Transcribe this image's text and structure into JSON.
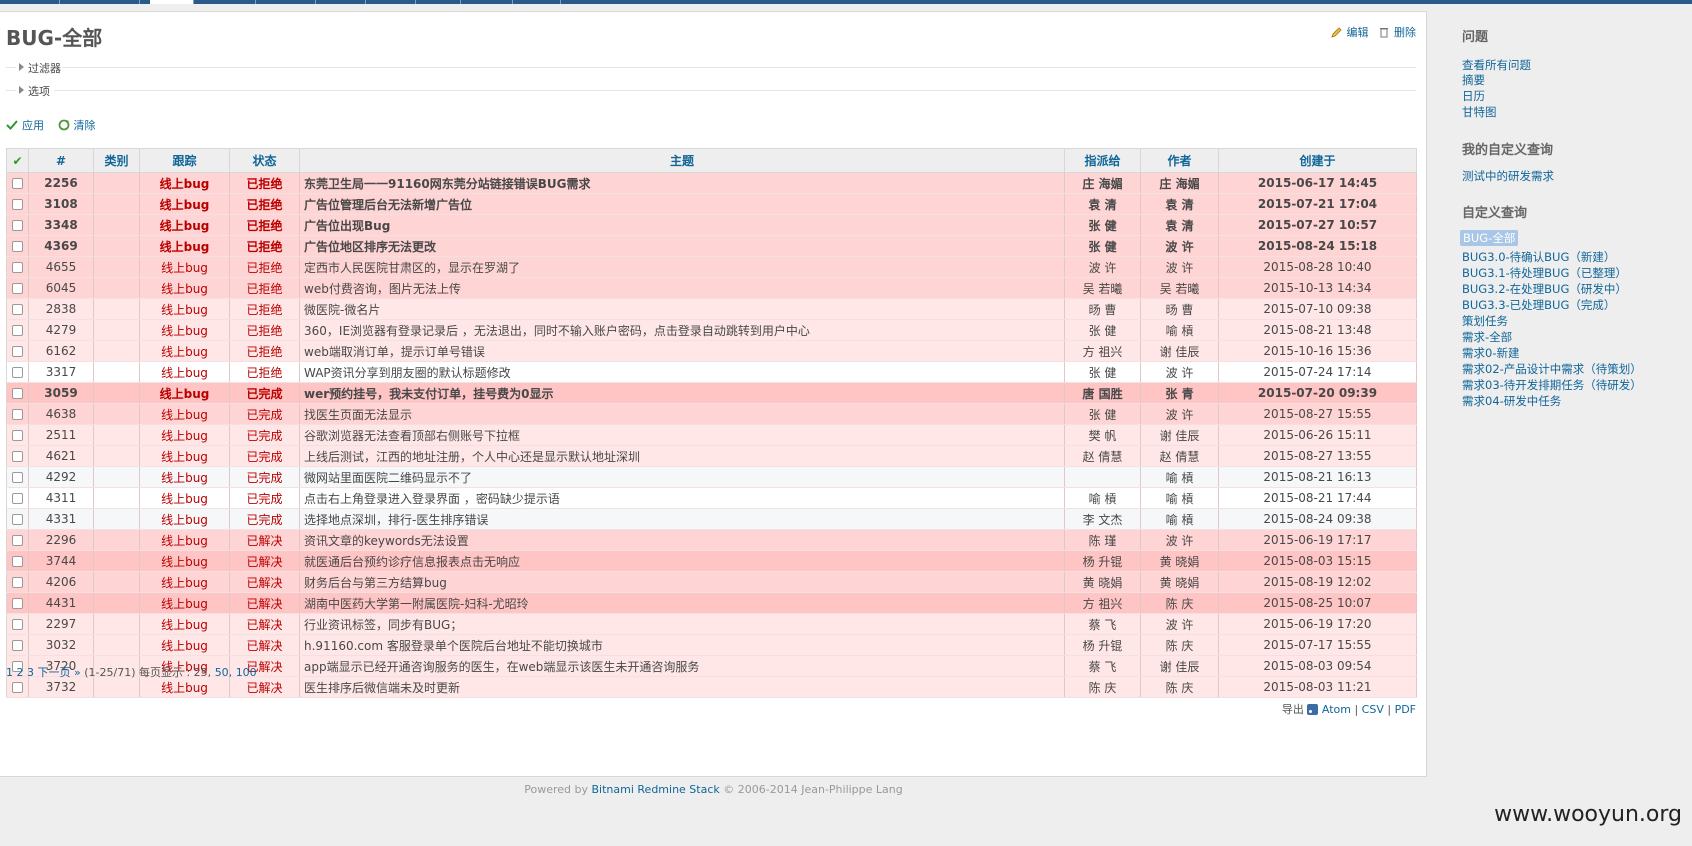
{
  "page_title": "BUG-全部",
  "contextual": {
    "edit": "编辑",
    "delete": "删除"
  },
  "filters_label": "过滤器",
  "options_label": "选项",
  "buttons": {
    "apply": "应用",
    "clear": "清除"
  },
  "table": {
    "headers": {
      "check": "✔",
      "id": "#",
      "category": "类别",
      "tracker": "跟踪",
      "status": "状态",
      "subject": "主题",
      "assignee": "指派给",
      "author": "作者",
      "created": "创建于"
    },
    "rows": [
      {
        "id": "2256",
        "tracker": "线上bug",
        "status": "已拒绝",
        "subject": "东莞卫生局一一91160网东莞分站链接错误BUG需求",
        "assignee": "庄 海媚",
        "author": "庄 海媚",
        "created": "2015-06-17 14:45",
        "style": "p-normal",
        "bold": true
      },
      {
        "id": "3108",
        "tracker": "线上bug",
        "status": "已拒绝",
        "subject": "广告位管理后台无法新增广告位",
        "assignee": "袁 清",
        "author": "袁 清",
        "created": "2015-07-21 17:04",
        "style": "p-normal",
        "bold": true
      },
      {
        "id": "3348",
        "tracker": "线上bug",
        "status": "已拒绝",
        "subject": "广告位出现Bug",
        "assignee": "张 健",
        "author": "袁 清",
        "created": "2015-07-27 10:57",
        "style": "p-normal",
        "bold": true
      },
      {
        "id": "4369",
        "tracker": "线上bug",
        "status": "已拒绝",
        "subject": "广告位地区排序无法更改",
        "assignee": "张 健",
        "author": "波 许",
        "created": "2015-08-24 15:18",
        "style": "p-normal",
        "bold": true
      },
      {
        "id": "4655",
        "tracker": "线上bug",
        "status": "已拒绝",
        "subject": "定西市人民医院甘肃区的，显示在罗湖了",
        "assignee": "波 许",
        "author": "波 许",
        "created": "2015-08-28 10:40",
        "style": "p-normal",
        "bold": false
      },
      {
        "id": "6045",
        "tracker": "线上bug",
        "status": "已拒绝",
        "subject": "web付费咨询，图片无法上传",
        "assignee": "吴 若曦",
        "author": "吴 若曦",
        "created": "2015-10-13 14:34",
        "style": "p-normal",
        "bold": false
      },
      {
        "id": "2838",
        "tracker": "线上bug",
        "status": "已拒绝",
        "subject": "微医院-微名片",
        "assignee": "旸 曹",
        "author": "旸 曹",
        "created": "2015-07-10 09:38",
        "style": "p-low",
        "bold": false
      },
      {
        "id": "4279",
        "tracker": "线上bug",
        "status": "已拒绝",
        "subject": "360，IE浏览器有登录记录后 ，无法退出，同时不输入账户密码，点击登录自动跳转到用户中心",
        "assignee": "张 健",
        "author": "喻 槓",
        "created": "2015-08-21 13:48",
        "style": "p-low",
        "bold": false
      },
      {
        "id": "6162",
        "tracker": "线上bug",
        "status": "已拒绝",
        "subject": "web端取消订单，提示订单号错误",
        "assignee": "方 祖兴",
        "author": "谢 佳辰",
        "created": "2015-10-16 15:36",
        "style": "p-low",
        "bold": false
      },
      {
        "id": "3317",
        "tracker": "线上bug",
        "status": "已拒绝",
        "subject": "WAP资讯分享到朋友圈的默认标题修改",
        "assignee": "张 健",
        "author": "波 许",
        "created": "2015-07-24 17:14",
        "style": "p-none",
        "bold": false
      },
      {
        "id": "3059",
        "tracker": "线上bug",
        "status": "已完成",
        "subject": "wer预约挂号，我未支付订单，挂号费为0显示",
        "assignee": "唐 国胜",
        "author": "张 青",
        "created": "2015-07-20 09:39",
        "style": "p-high",
        "bold": true
      },
      {
        "id": "4638",
        "tracker": "线上bug",
        "status": "已完成",
        "subject": "找医生页面无法显示",
        "assignee": "张 健",
        "author": "波 许",
        "created": "2015-08-27 15:55",
        "style": "p-normal",
        "bold": false
      },
      {
        "id": "2511",
        "tracker": "线上bug",
        "status": "已完成",
        "subject": "谷歌浏览器无法查看顶部右侧账号下拉框",
        "assignee": "樊 帆",
        "author": "谢 佳辰",
        "created": "2015-06-26 15:11",
        "style": "p-low",
        "bold": false
      },
      {
        "id": "4621",
        "tracker": "线上bug",
        "status": "已完成",
        "subject": "上线后测试，江西的地址注册，个人中心还是显示默认地址深圳",
        "assignee": "赵 倩慧",
        "author": "赵 倩慧",
        "created": "2015-08-27 13:55",
        "style": "p-low",
        "bold": false
      },
      {
        "id": "4292",
        "tracker": "线上bug",
        "status": "已完成",
        "subject": "微网站里面医院二维码显示不了",
        "assignee": "",
        "author": "喻 槓",
        "created": "2015-08-21 16:13",
        "style": "p-gray",
        "bold": false
      },
      {
        "id": "4311",
        "tracker": "线上bug",
        "status": "已完成",
        "subject": "点击右上角登录进入登录界面 ，密码缺少提示语",
        "assignee": "喻 槓",
        "author": "喻 槓",
        "created": "2015-08-21 17:44",
        "style": "p-none",
        "bold": false
      },
      {
        "id": "4331",
        "tracker": "线上bug",
        "status": "已完成",
        "subject": "选择地点深圳，排行-医生排序错误",
        "assignee": "李 文杰",
        "author": "喻 槓",
        "created": "2015-08-24 09:38",
        "style": "p-gray",
        "bold": false
      },
      {
        "id": "2296",
        "tracker": "线上bug",
        "status": "已解决",
        "subject": "资讯文章的keywords无法设置",
        "assignee": "陈 瑾",
        "author": "波 许",
        "created": "2015-06-19 17:17",
        "style": "p-normal",
        "bold": false
      },
      {
        "id": "3744",
        "tracker": "线上bug",
        "status": "已解决",
        "subject": "就医通后台预约诊疗信息报表点击无响应",
        "assignee": "杨 升锟",
        "author": "黄 晓娟",
        "created": "2015-08-03 15:15",
        "style": "p-high",
        "bold": false
      },
      {
        "id": "4206",
        "tracker": "线上bug",
        "status": "已解决",
        "subject": "财务后台与第三方结算bug",
        "assignee": "黄 晓娟",
        "author": "黄 晓娟",
        "created": "2015-08-19 12:02",
        "style": "p-normal",
        "bold": false
      },
      {
        "id": "4431",
        "tracker": "线上bug",
        "status": "已解决",
        "subject": "湖南中医药大学第一附属医院-妇科-尤昭玲",
        "assignee": "方 祖兴",
        "author": "陈 庆",
        "created": "2015-08-25 10:07",
        "style": "p-high",
        "bold": false
      },
      {
        "id": "2297",
        "tracker": "线上bug",
        "status": "已解决",
        "subject": "行业资讯标签，同步有BUG；",
        "assignee": "蔡 飞",
        "author": "波 许",
        "created": "2015-06-19 17:20",
        "style": "p-low",
        "bold": false
      },
      {
        "id": "3032",
        "tracker": "线上bug",
        "status": "已解决",
        "subject": "h.91160.com 客服登录单个医院后台地址不能切换城市",
        "assignee": "杨 升锟",
        "author": "陈 庆",
        "created": "2015-07-17 15:55",
        "style": "p-low",
        "bold": false
      },
      {
        "id": "3720",
        "tracker": "线上bug",
        "status": "已解决",
        "subject": "app端显示已经开通咨询服务的医生，在web端显示该医生未开通咨询服务",
        "assignee": "蔡 飞",
        "author": "谢 佳辰",
        "created": "2015-08-03 09:54",
        "style": "p-low",
        "bold": false
      },
      {
        "id": "3732",
        "tracker": "线上bug",
        "status": "已解决",
        "subject": "医生排序后微信端未及时更新",
        "assignee": "陈 庆",
        "author": "陈 庆",
        "created": "2015-08-03 11:21",
        "style": "p-low",
        "bold": false
      }
    ]
  },
  "pagination": {
    "p1": "1",
    "p2": "2",
    "p3": "3",
    "next": "下一页 »",
    "range": "(1-25/71) 每页显示 : 25,",
    "pp50": "50,",
    "pp100": "100"
  },
  "exports": {
    "label": "导出",
    "atom": "Atom",
    "csv": "CSV",
    "pdf": "PDF"
  },
  "footer": {
    "powered": "Powered by",
    "link": "Bitnami Redmine Stack",
    "copy": "© 2006-2014 Jean-Philippe Lang"
  },
  "watermark": "www.wooyun.org",
  "sidebar": {
    "issues_title": "问题",
    "issues_links": [
      "查看所有问题",
      "摘要",
      "日历",
      "甘特图"
    ],
    "my_queries_title": "我的自定义查询",
    "my_queries": [
      "测试中的研发需求"
    ],
    "custom_title": "自定义查询",
    "custom_queries": [
      "BUG-全部",
      "BUG3.0-待确认BUG（新建）",
      "BUG3.1-待处理BUG（已整理）",
      "BUG3.2-在处理BUG（研发中）",
      "BUG3.3-已处理BUG（完成）",
      "策划任务",
      "需求-全部",
      "需求0-新建",
      "需求02-产品设计中需求（待策划）",
      "需求03-待开发排期任务（待研发）",
      "需求04-研发中任务"
    ]
  },
  "colors": {
    "accent": "#116699",
    "high": "#ffc4c4",
    "normal": "#ffd4d4",
    "low": "#ffe7e7"
  }
}
